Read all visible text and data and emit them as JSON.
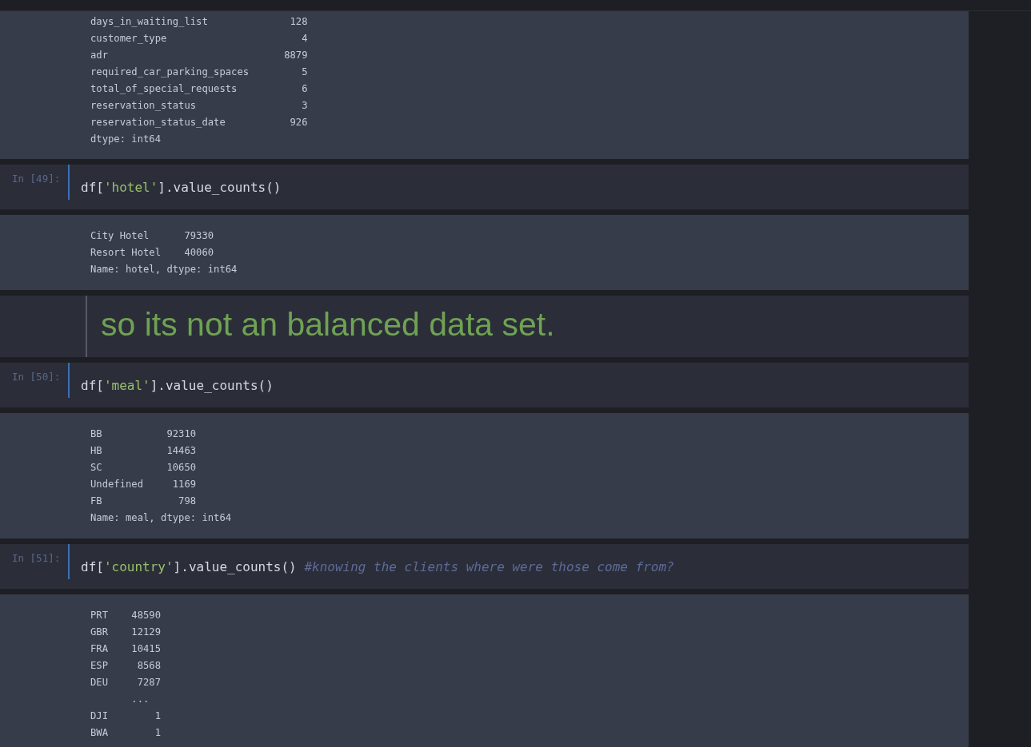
{
  "cells": [
    {
      "kind": "output",
      "lines": [
        "days_in_waiting_list              128",
        "customer_type                       4",
        "adr                              8879",
        "required_car_parking_spaces         5",
        "total_of_special_requests           6",
        "reservation_status                  3",
        "reservation_status_date           926",
        "dtype: int64"
      ]
    },
    {
      "kind": "code",
      "prompt": "In [49]:",
      "tokens": [
        {
          "kind": "plain",
          "text": "df["
        },
        {
          "kind": "string",
          "text": "'hotel'"
        },
        {
          "kind": "plain",
          "text": "].value_counts()"
        }
      ]
    },
    {
      "kind": "output",
      "lines": [
        "City Hotel      79330",
        "Resort Hotel    40060",
        "Name: hotel, dtype: int64"
      ]
    },
    {
      "kind": "markdown",
      "text": "so its not an balanced data set."
    },
    {
      "kind": "code",
      "prompt": "In [50]:",
      "tokens": [
        {
          "kind": "plain",
          "text": "df["
        },
        {
          "kind": "string",
          "text": "'meal'"
        },
        {
          "kind": "plain",
          "text": "].value_counts()"
        }
      ]
    },
    {
      "kind": "output",
      "lines": [
        "BB           92310",
        "HB           14463",
        "SC           10650",
        "Undefined     1169",
        "FB             798",
        "Name: meal, dtype: int64"
      ]
    },
    {
      "kind": "code",
      "prompt": "In [51]:",
      "tokens": [
        {
          "kind": "plain",
          "text": "df["
        },
        {
          "kind": "string",
          "text": "'country'"
        },
        {
          "kind": "plain",
          "text": "].value_counts() "
        },
        {
          "kind": "comment",
          "text": "#knowing the clients where were those come from?"
        }
      ]
    },
    {
      "kind": "output",
      "lines": [
        "PRT    48590",
        "GBR    12129",
        "FRA    10415",
        "ESP     8568",
        "DEU     7287",
        "       ...",
        "DJI        1",
        "BWA        1"
      ]
    }
  ]
}
